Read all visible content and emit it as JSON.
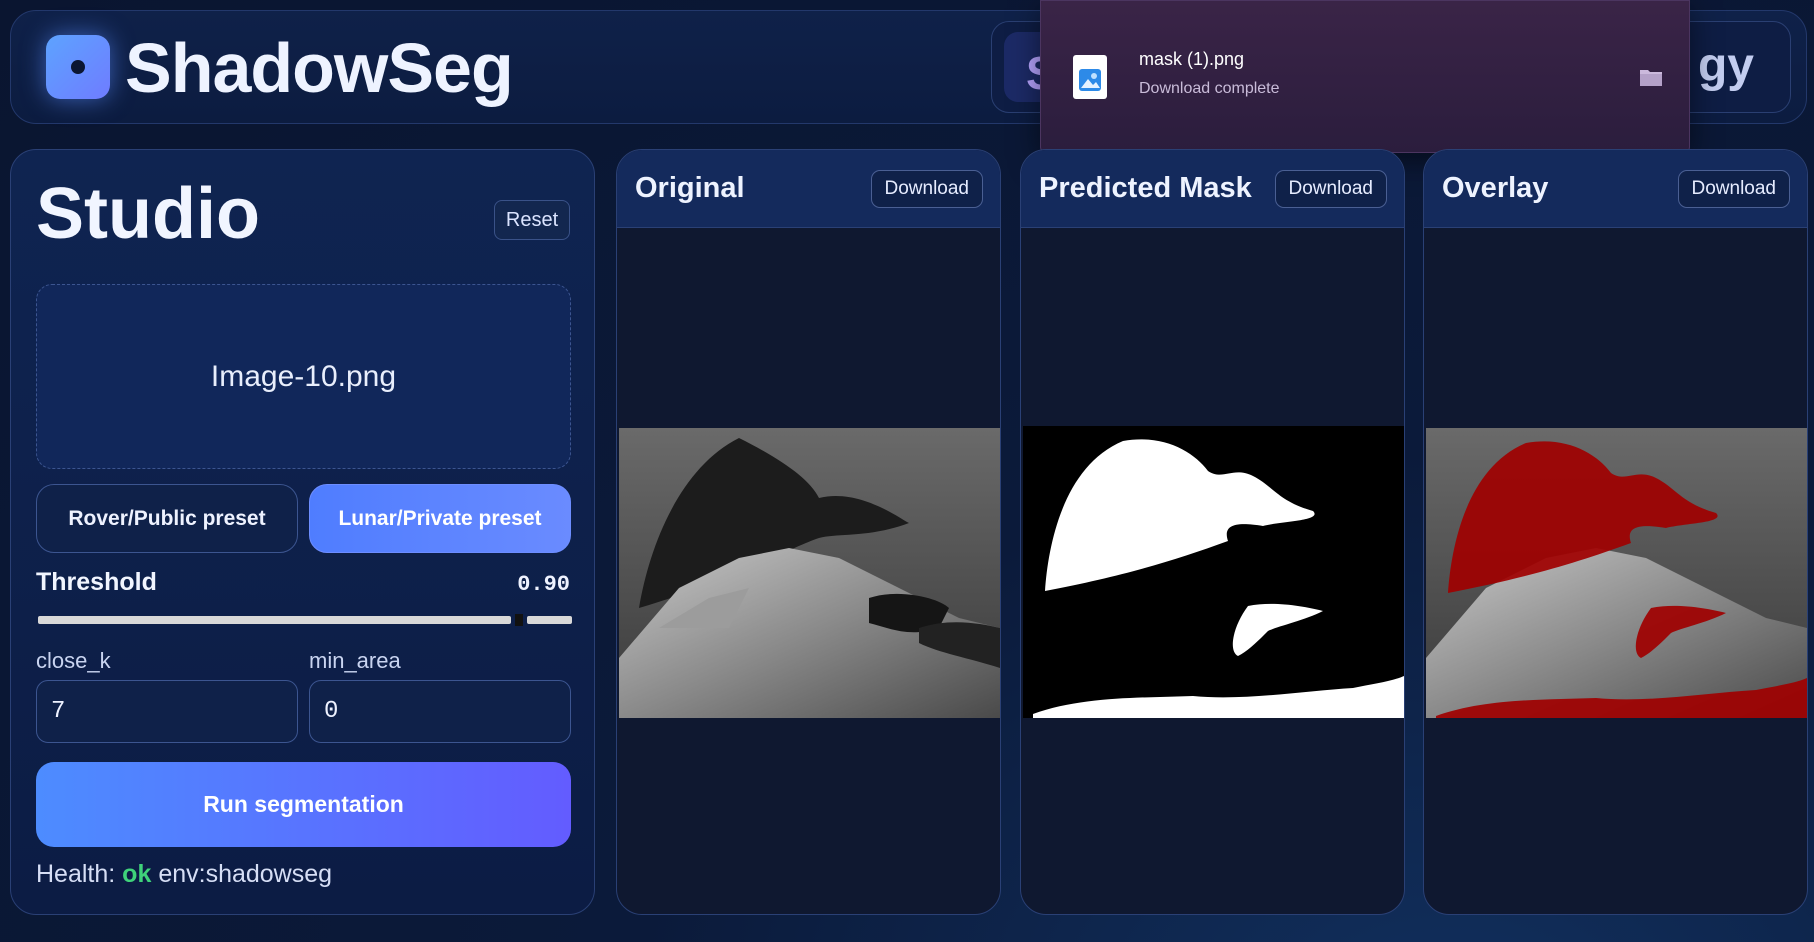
{
  "header": {
    "app_title": "ShadowSeg",
    "nav_active_fragment": "S",
    "nav_end_fragment": "gy"
  },
  "download_popup": {
    "file_name": "mask (1).png",
    "status": "Download complete"
  },
  "studio": {
    "title": "Studio",
    "reset_label": "Reset",
    "file_name": "Image-10.png",
    "preset_public": "Rover/Public preset",
    "preset_private": "Lunar/Private preset",
    "threshold_label": "Threshold",
    "threshold_value": "0.90",
    "threshold_fraction": 0.9,
    "close_k_label": "close_k",
    "close_k_value": "7",
    "min_area_label": "min_area",
    "min_area_value": "0",
    "run_label": "Run segmentation",
    "health_label": "Health:",
    "health_status": "ok",
    "health_env": "env:shadowseg"
  },
  "panels": [
    {
      "title": "Original",
      "download_label": "Download"
    },
    {
      "title": "Predicted Mask",
      "download_label": "Download"
    },
    {
      "title": "Overlay",
      "download_label": "Download"
    }
  ],
  "colors": {
    "accent": "#4f7dff",
    "ok": "#3fd27a",
    "overlay_red": "#a00000"
  }
}
